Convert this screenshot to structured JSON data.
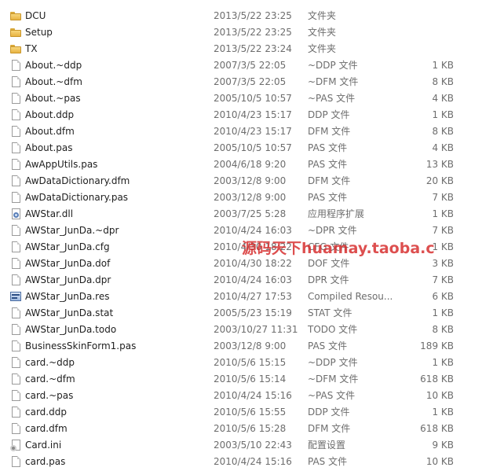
{
  "colors": {
    "name_text": "#1e1e1e",
    "meta_text": "#6d6d6d",
    "folder": "#e8b443",
    "watermark": "#d62828"
  },
  "files": [
    {
      "name": "DCU",
      "date": "2013/5/22 23:25",
      "type": "文件夹",
      "size": "",
      "icon": "folder-icon"
    },
    {
      "name": "Setup",
      "date": "2013/5/22 23:25",
      "type": "文件夹",
      "size": "",
      "icon": "folder-icon"
    },
    {
      "name": "TX",
      "date": "2013/5/22 23:24",
      "type": "文件夹",
      "size": "",
      "icon": "folder-icon"
    },
    {
      "name": "About.~ddp",
      "date": "2007/3/5 22:05",
      "type": "~DDP 文件",
      "size": "1 KB",
      "icon": "file-icon"
    },
    {
      "name": "About.~dfm",
      "date": "2007/3/5 22:05",
      "type": "~DFM 文件",
      "size": "8 KB",
      "icon": "file-icon"
    },
    {
      "name": "About.~pas",
      "date": "2005/10/5 10:57",
      "type": "~PAS 文件",
      "size": "4 KB",
      "icon": "file-icon"
    },
    {
      "name": "About.ddp",
      "date": "2010/4/23 15:17",
      "type": "DDP 文件",
      "size": "1 KB",
      "icon": "file-icon"
    },
    {
      "name": "About.dfm",
      "date": "2010/4/23 15:17",
      "type": "DFM 文件",
      "size": "8 KB",
      "icon": "file-icon"
    },
    {
      "name": "About.pas",
      "date": "2005/10/5 10:57",
      "type": "PAS 文件",
      "size": "4 KB",
      "icon": "file-icon"
    },
    {
      "name": "AwAppUtils.pas",
      "date": "2004/6/18 9:20",
      "type": "PAS 文件",
      "size": "13 KB",
      "icon": "file-icon"
    },
    {
      "name": "AwDataDictionary.dfm",
      "date": "2003/12/8 9:00",
      "type": "DFM 文件",
      "size": "20 KB",
      "icon": "file-icon"
    },
    {
      "name": "AwDataDictionary.pas",
      "date": "2003/12/8 9:00",
      "type": "PAS 文件",
      "size": "7 KB",
      "icon": "file-icon"
    },
    {
      "name": "AWStar.dll",
      "date": "2003/7/25 5:28",
      "type": "应用程序扩展",
      "size": "1 KB",
      "icon": "dll-icon"
    },
    {
      "name": "AWStar_JunDa.~dpr",
      "date": "2010/4/24 16:03",
      "type": "~DPR 文件",
      "size": "7 KB",
      "icon": "file-icon"
    },
    {
      "name": "AWStar_JunDa.cfg",
      "date": "2010/4/30 18:22",
      "type": "CFG 文件",
      "size": "1 KB",
      "icon": "file-icon"
    },
    {
      "name": "AWStar_JunDa.dof",
      "date": "2010/4/30 18:22",
      "type": "DOF 文件",
      "size": "3 KB",
      "icon": "file-icon"
    },
    {
      "name": "AWStar_JunDa.dpr",
      "date": "2010/4/24 16:03",
      "type": "DPR 文件",
      "size": "7 KB",
      "icon": "file-icon"
    },
    {
      "name": "AWStar_JunDa.res",
      "date": "2010/4/27 17:53",
      "type": "Compiled Resou...",
      "size": "6 KB",
      "icon": "resource-icon"
    },
    {
      "name": "AWStar_JunDa.stat",
      "date": "2005/5/23 15:19",
      "type": "STAT 文件",
      "size": "1 KB",
      "icon": "file-icon"
    },
    {
      "name": "AWStar_JunDa.todo",
      "date": "2003/10/27 11:31",
      "type": "TODO 文件",
      "size": "8 KB",
      "icon": "file-icon"
    },
    {
      "name": "BusinessSkinForm1.pas",
      "date": "2003/12/8 9:00",
      "type": "PAS 文件",
      "size": "189 KB",
      "icon": "file-icon"
    },
    {
      "name": "card.~ddp",
      "date": "2010/5/6 15:15",
      "type": "~DDP 文件",
      "size": "1 KB",
      "icon": "file-icon"
    },
    {
      "name": "card.~dfm",
      "date": "2010/5/6 15:14",
      "type": "~DFM 文件",
      "size": "618 KB",
      "icon": "file-icon"
    },
    {
      "name": "card.~pas",
      "date": "2010/4/24 15:16",
      "type": "~PAS 文件",
      "size": "10 KB",
      "icon": "file-icon"
    },
    {
      "name": "card.ddp",
      "date": "2010/5/6 15:55",
      "type": "DDP 文件",
      "size": "1 KB",
      "icon": "file-icon"
    },
    {
      "name": "card.dfm",
      "date": "2010/5/6 15:28",
      "type": "DFM 文件",
      "size": "618 KB",
      "icon": "file-icon"
    },
    {
      "name": "Card.ini",
      "date": "2003/5/10 22:43",
      "type": "配置设置",
      "size": "9 KB",
      "icon": "ini-icon"
    },
    {
      "name": "card.pas",
      "date": "2010/4/24 15:16",
      "type": "PAS 文件",
      "size": "10 KB",
      "icon": "file-icon"
    }
  ],
  "watermark": "源码天下huamay.taoba.c"
}
